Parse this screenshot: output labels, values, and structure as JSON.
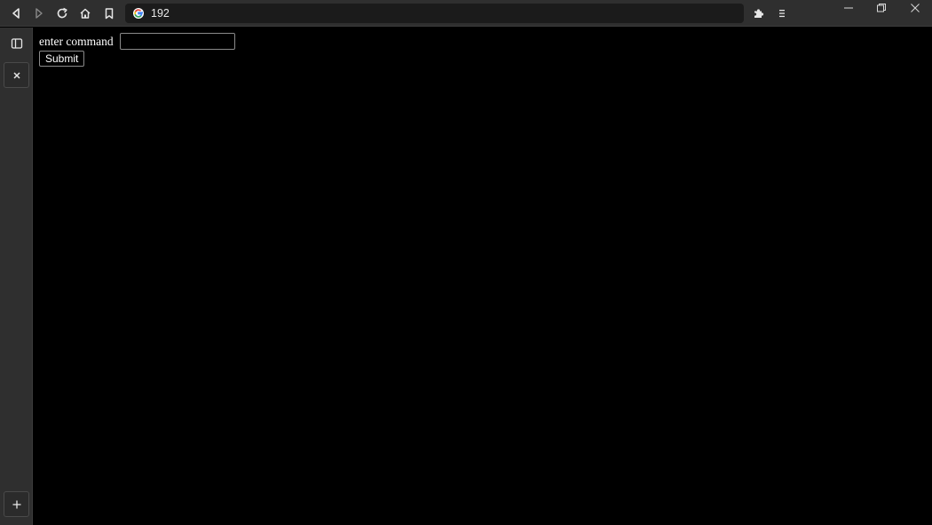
{
  "browser": {
    "address": "192",
    "search_engine_icon": "google-icon",
    "nav_icons": [
      "back-icon",
      "forward-icon",
      "reload-icon",
      "home-icon",
      "bookmark-icon"
    ],
    "right_icons": [
      "extensions-icon",
      "menu-icon"
    ],
    "window_controls": [
      "minimize-icon",
      "restore-icon",
      "close-icon"
    ]
  },
  "sidebar": {
    "icons": [
      "sidebar-panel-icon",
      "close-tab-icon",
      "new-tab-plus-icon"
    ]
  },
  "page": {
    "label": "enter command",
    "input_value": "",
    "submit_label": "Submit"
  },
  "colors": {
    "page_background": "#000000",
    "chrome_background": "#2f2f2f",
    "address_bar_background": "#1b1b1b",
    "text": "#ffffff"
  }
}
